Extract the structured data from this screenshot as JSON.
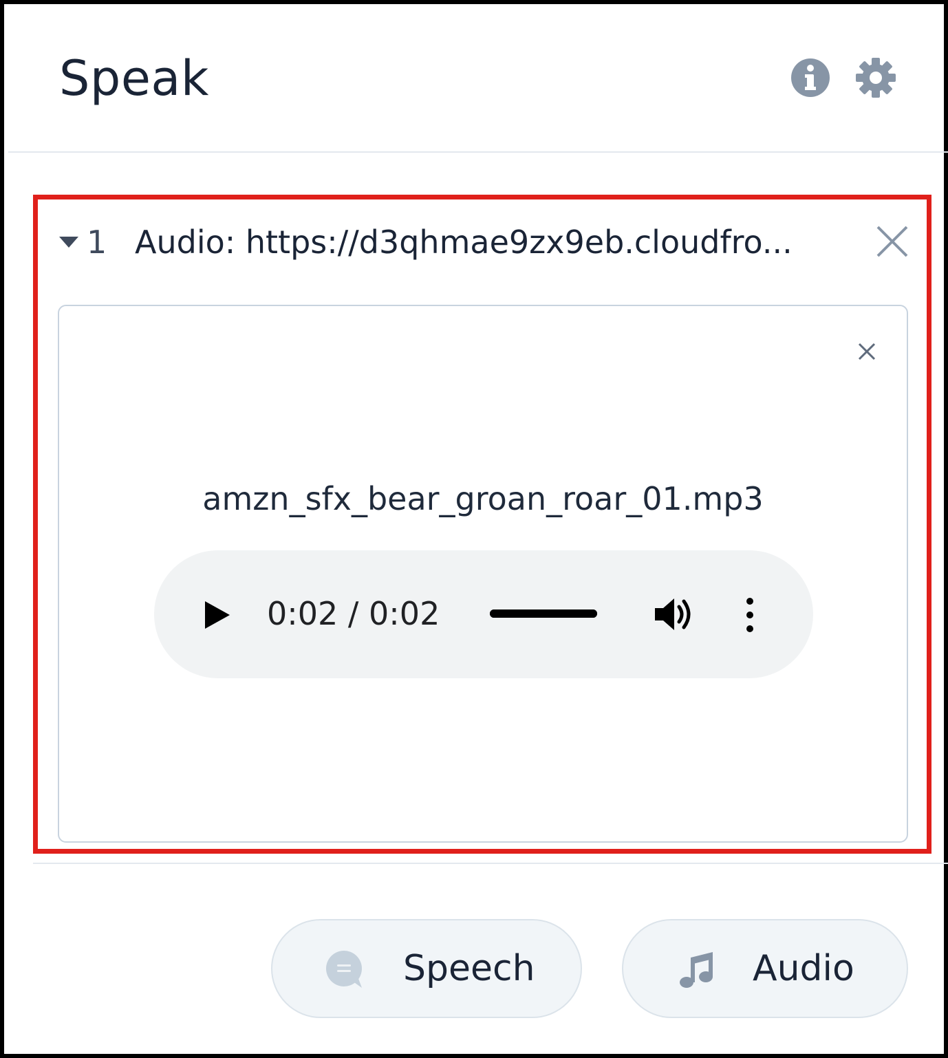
{
  "header": {
    "title": "Speak",
    "info_icon": "info-icon",
    "settings_icon": "gear-icon"
  },
  "item": {
    "index": "1",
    "title": "Audio: https://d3qhmae9zx9eb.cloudfro...",
    "caret_icon": "caret-down-icon",
    "close_icon": "close-icon"
  },
  "audio_card": {
    "file_name": "amzn_sfx_bear_groan_roar_01.mp3",
    "close_icon": "close-icon",
    "player": {
      "time": "0:02 / 0:02",
      "progress_fraction": 1.0,
      "play_icon": "play-icon",
      "volume_icon": "volume-icon",
      "more_icon": "more-vertical-icon"
    }
  },
  "actions": {
    "speech_label": "Speech",
    "speech_icon": "speech-bubble-icon",
    "audio_label": "Audio",
    "audio_icon": "music-note-icon"
  },
  "colors": {
    "highlight_border": "#e0201b",
    "text_primary": "#1a2436",
    "icon_gray": "#8795a6",
    "player_bg": "#f1f3f4",
    "pill_bg": "#f1f5f8"
  }
}
